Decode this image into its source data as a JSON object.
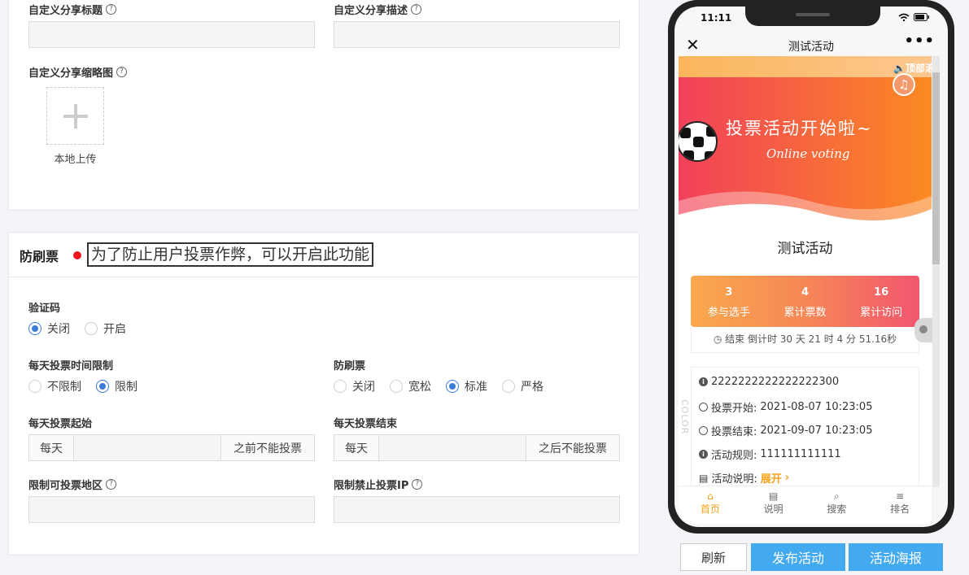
{
  "share": {
    "title_label": "自定义分享标题",
    "desc_label": "自定义分享描述",
    "thumb_label": "自定义分享缩略图",
    "upload_caption": "本地上传"
  },
  "anti_fraud": {
    "section_title": "防刷票",
    "hint": "为了防止用户投票作弊，可以开启此功能",
    "captcha": {
      "label": "验证码",
      "options": [
        "关闭",
        "开启"
      ],
      "selected": "关闭"
    },
    "daily_limit": {
      "label": "每天投票时间限制",
      "options": [
        "不限制",
        "限制"
      ],
      "selected": "限制"
    },
    "anti_brush": {
      "label": "防刷票",
      "options": [
        "关闭",
        "宽松",
        "标准",
        "严格"
      ],
      "selected": "标准"
    },
    "daily_start": {
      "label": "每天投票起始",
      "prefix": "每天",
      "suffix": "之前不能投票"
    },
    "daily_end": {
      "label": "每天投票结束",
      "prefix": "每天",
      "suffix": "之后不能投票"
    },
    "region_label": "限制可投票地区",
    "ip_label": "限制禁止投票IP"
  },
  "phone": {
    "time": "11:11",
    "nav_title": "测试活动",
    "notice_text": "顶部滚",
    "banner_title": "投票活动开始啦~",
    "banner_subtitle": "Online voting",
    "activity_title": "测试活动",
    "stats": [
      {
        "value": "3",
        "label": "参与选手"
      },
      {
        "value": "4",
        "label": "累计票数"
      },
      {
        "value": "16",
        "label": "累计访问"
      }
    ],
    "countdown": "结束 倒计时 30 天 21 时 4 分 51.16秒",
    "info": {
      "code": "2222222222222222300",
      "start_label": "投票开始:",
      "start_value": "2021-08-07 10:23:05",
      "end_label": "投票结束:",
      "end_value": "2021-09-07 10:23:05",
      "rules_label": "活动规则:",
      "rules_value": "111111111111",
      "desc_label": "活动说明:",
      "expand": "展开"
    },
    "side_text": "COLOR",
    "tabs": [
      "首页",
      "说明",
      "搜索",
      "排名"
    ]
  },
  "buttons": {
    "refresh": "刷新",
    "publish": "发布活动",
    "poster": "活动海报"
  },
  "colors": {
    "accent_blue": "#44aaf0",
    "radio_blue": "#3a7bd5",
    "orange": "#f7a21b",
    "red_dot": "#f0141e"
  }
}
